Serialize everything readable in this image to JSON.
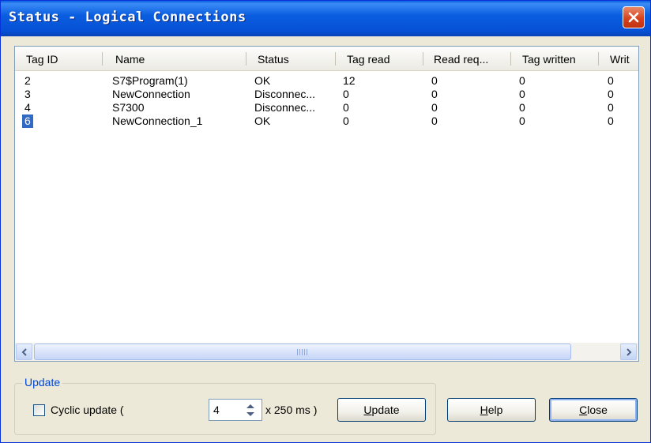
{
  "window": {
    "title": "Status - Logical Connections"
  },
  "table": {
    "columns": [
      "Tag ID",
      "Name",
      "Status",
      "Tag read",
      "Read req...",
      "Tag written",
      "Writ"
    ],
    "rows": [
      {
        "tag_id": "2",
        "name": "S7$Program(1)",
        "status": "OK",
        "tag_read": "12",
        "read_req": "0",
        "tag_written": "0",
        "write": "0"
      },
      {
        "tag_id": "3",
        "name": "NewConnection",
        "status": "Disconnec...",
        "tag_read": "0",
        "read_req": "0",
        "tag_written": "0",
        "write": "0"
      },
      {
        "tag_id": "4",
        "name": "S7300",
        "status": "Disconnec...",
        "tag_read": "0",
        "read_req": "0",
        "tag_written": "0",
        "write": "0"
      },
      {
        "tag_id": "6",
        "name": "NewConnection_1",
        "status": "OK",
        "tag_read": "0",
        "read_req": "0",
        "tag_written": "0",
        "write": "0"
      }
    ],
    "selected_row": 3
  },
  "update": {
    "group_label": "Update",
    "cyclic_label": "Cyclic update (",
    "cyclic_checked": false,
    "interval_value": "4",
    "unit_label": "x 250 ms )"
  },
  "buttons": {
    "update_first": "U",
    "update_rest": "pdate",
    "help_first": "H",
    "help_rest": "elp",
    "close_first": "C",
    "close_rest": "lose"
  },
  "icons": {
    "close": "close-x-icon",
    "scroll_left": "arrow-left-icon",
    "scroll_right": "arrow-right-icon",
    "spin_up": "spin-up-icon",
    "spin_down": "spin-down-icon"
  },
  "colors": {
    "titlebar": "#0a5fe0",
    "selection": "#316ac5",
    "close_button": "#d6431e"
  }
}
